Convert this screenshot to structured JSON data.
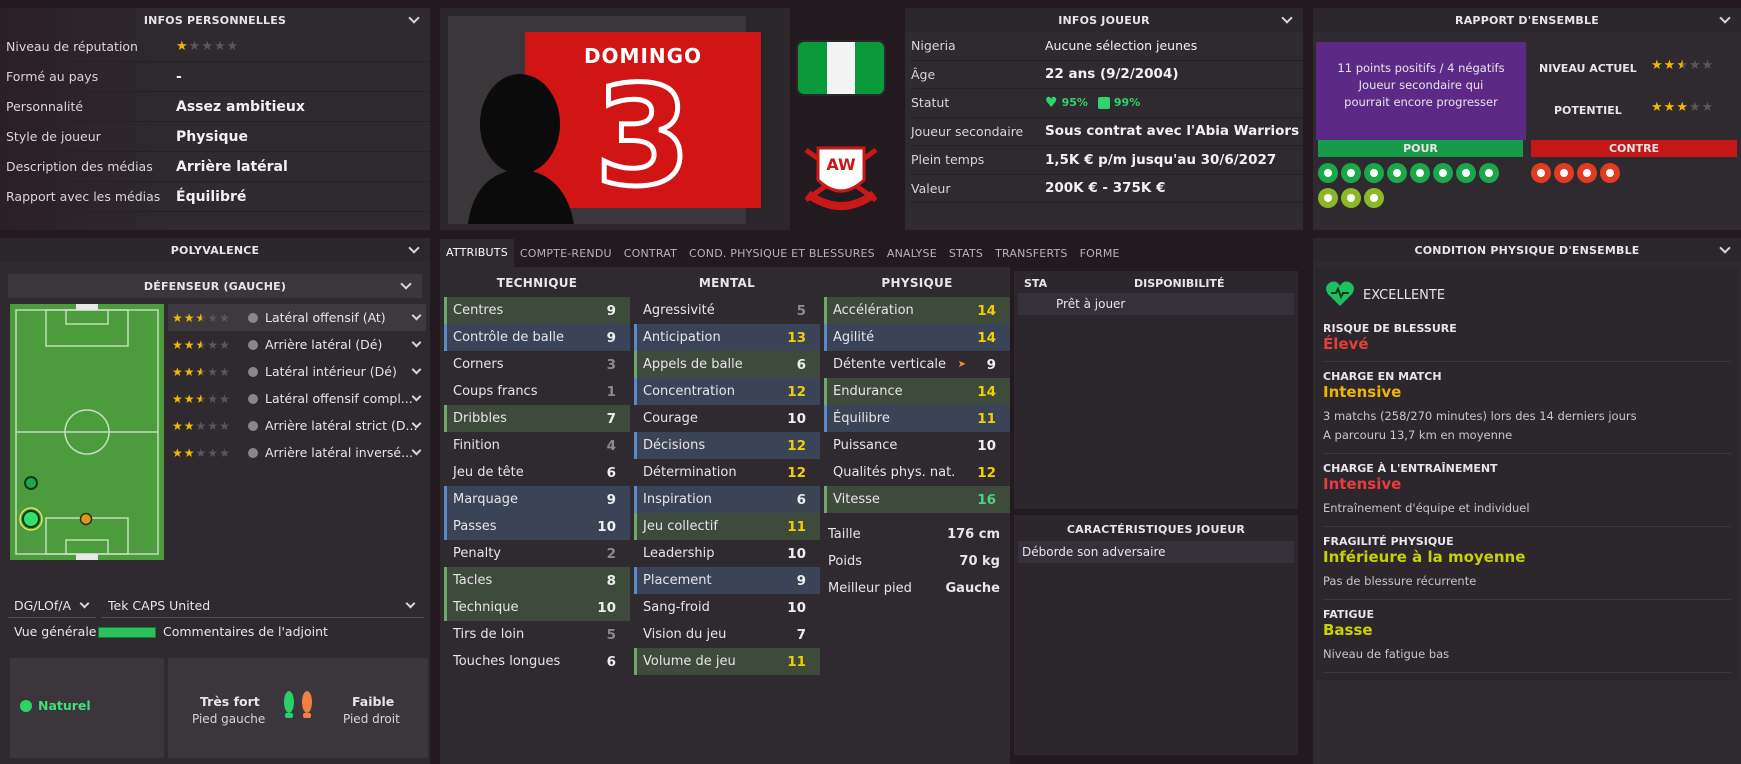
{
  "personal": {
    "header": "INFOS PERSONNELLES",
    "rows": [
      {
        "label": "Niveau de réputation",
        "value": "",
        "stars": 1
      },
      {
        "label": "Formé au pays",
        "value": "-"
      },
      {
        "label": "Personnalité",
        "value": "Assez ambitieux"
      },
      {
        "label": "Style de joueur",
        "value": "Physique"
      },
      {
        "label": "Description des médias",
        "value": "Arrière latéral"
      },
      {
        "label": "Rapport avec les médias",
        "value": "Équilibré"
      }
    ]
  },
  "shirt": {
    "name": "DOMINGO",
    "number": "3"
  },
  "club_badge": {
    "text": "ABIA WARRIORS FC"
  },
  "player_info": {
    "header": "INFOS JOUEUR",
    "rows": [
      {
        "label": "Nigeria",
        "value": "Aucune sélection jeunes"
      },
      {
        "label": "Âge",
        "value": "22 ans (9/2/2004)"
      },
      {
        "label": "Statut",
        "value": ""
      },
      {
        "label": "Joueur secondaire",
        "value": "Sous contrat avec l'Abia Warriors"
      },
      {
        "label": "Plein temps",
        "value": "1,5K € p/m jusqu'au 30/6/2027"
      },
      {
        "label": "Valeur",
        "value": "200K € - 375K €"
      }
    ],
    "status": {
      "condition": "95%",
      "morale": "99%"
    }
  },
  "overview": {
    "header": "RAPPORT D'ENSEMBLE",
    "summary_line1": "11 points positifs / 4 négatifs",
    "summary_line2": "Joueur secondaire qui pourrait encore progresser",
    "current_label": "NIVEAU ACTUEL",
    "current_stars": 2.5,
    "potential_label": "POTENTIEL",
    "potential_stars": 3,
    "pour": "POUR",
    "contre": "CONTRE",
    "pour_count": 11,
    "contre_count": 4
  },
  "versatility": {
    "header": "POLYVALENCE",
    "position_header": "DÉFENSEUR (GAUCHE)",
    "roles": [
      {
        "stars": 2.5,
        "label": "Latéral offensif (At)"
      },
      {
        "stars": 2.5,
        "label": "Arrière latéral (Dé)"
      },
      {
        "stars": 2.5,
        "label": "Latéral intérieur (Dé)"
      },
      {
        "stars": 2.5,
        "label": "Latéral offensif compl..."
      },
      {
        "stars": 2,
        "label": "Arrière latéral strict (D..."
      },
      {
        "stars": 2,
        "label": "Arrière latéral inversé..."
      }
    ],
    "position_select": "DG/LOf/A",
    "team_select": "Tek CAPS United",
    "overview_label": "Vue générale",
    "assistant_label": "Commentaires de l'adjoint",
    "natural_label": "Naturel",
    "left_foot_top": "Très fort",
    "left_foot_bottom": "Pied gauche",
    "right_foot_top": "Faible",
    "right_foot_bottom": "Pied droit"
  },
  "tabs": [
    "ATTRIBUTS",
    "COMPTE-RENDU",
    "CONTRAT",
    "COND. PHYSIQUE ET BLESSURES",
    "ANALYSE",
    "STATS",
    "TRANSFERTS",
    "FORME"
  ],
  "attributes": {
    "technique_header": "TECHNIQUE",
    "mental_header": "MENTAL",
    "physique_header": "PHYSIQUE",
    "technique": [
      {
        "label": "Centres",
        "value": "9",
        "hl": "g",
        "c": "c1"
      },
      {
        "label": "Contrôle de balle",
        "value": "9",
        "hl": "b",
        "c": "c1"
      },
      {
        "label": "Corners",
        "value": "3",
        "hl": "",
        "c": "c2"
      },
      {
        "label": "Coups francs",
        "value": "1",
        "hl": "",
        "c": "c2"
      },
      {
        "label": "Dribbles",
        "value": "7",
        "hl": "g",
        "c": "c1"
      },
      {
        "label": "Finition",
        "value": "4",
        "hl": "",
        "c": "c2"
      },
      {
        "label": "Jeu de tête",
        "value": "6",
        "hl": "",
        "c": "c1"
      },
      {
        "label": "Marquage",
        "value": "9",
        "hl": "b",
        "c": "c1"
      },
      {
        "label": "Passes",
        "value": "10",
        "hl": "b",
        "c": "c1"
      },
      {
        "label": "Penalty",
        "value": "2",
        "hl": "",
        "c": "c2"
      },
      {
        "label": "Tacles",
        "value": "8",
        "hl": "g",
        "c": "c1"
      },
      {
        "label": "Technique",
        "value": "10",
        "hl": "g",
        "c": "c1"
      },
      {
        "label": "Tirs de loin",
        "value": "5",
        "hl": "",
        "c": "c2"
      },
      {
        "label": "Touches longues",
        "value": "6",
        "hl": "",
        "c": "c1"
      }
    ],
    "mental": [
      {
        "label": "Agressivité",
        "value": "5",
        "hl": "",
        "c": "c2"
      },
      {
        "label": "Anticipation",
        "value": "13",
        "hl": "b",
        "c": "cy"
      },
      {
        "label": "Appels de balle",
        "value": "6",
        "hl": "g",
        "c": "c1"
      },
      {
        "label": "Concentration",
        "value": "12",
        "hl": "b",
        "c": "cy"
      },
      {
        "label": "Courage",
        "value": "10",
        "hl": "",
        "c": "c1"
      },
      {
        "label": "Décisions",
        "value": "12",
        "hl": "b",
        "c": "cy"
      },
      {
        "label": "Détermination",
        "value": "12",
        "hl": "",
        "c": "cy"
      },
      {
        "label": "Inspiration",
        "value": "6",
        "hl": "b",
        "c": "c1"
      },
      {
        "label": "Jeu collectif",
        "value": "11",
        "hl": "g",
        "c": "cy"
      },
      {
        "label": "Leadership",
        "value": "10",
        "hl": "",
        "c": "c1"
      },
      {
        "label": "Placement",
        "value": "9",
        "hl": "b",
        "c": "c1"
      },
      {
        "label": "Sang-froid",
        "value": "10",
        "hl": "",
        "c": "c1"
      },
      {
        "label": "Vision du jeu",
        "value": "7",
        "hl": "",
        "c": "c1"
      },
      {
        "label": "Volume de jeu",
        "value": "11",
        "hl": "g",
        "c": "cy"
      }
    ],
    "physique": [
      {
        "label": "Accélération",
        "value": "14",
        "hl": "g",
        "c": "cy"
      },
      {
        "label": "Agilité",
        "value": "14",
        "hl": "b",
        "c": "cy"
      },
      {
        "label": "Détente verticale",
        "value": "9",
        "hl": "",
        "c": "c1"
      },
      {
        "label": "Endurance",
        "value": "14",
        "hl": "g",
        "c": "cy"
      },
      {
        "label": "Équilibre",
        "value": "11",
        "hl": "b",
        "c": "cy"
      },
      {
        "label": "Puissance",
        "value": "10",
        "hl": "",
        "c": "c1"
      },
      {
        "label": "Qualités phys. nat.",
        "value": "12",
        "hl": "",
        "c": "cy"
      },
      {
        "label": "Vitesse",
        "value": "16",
        "hl": "g",
        "c": "cg"
      }
    ],
    "height_label": "Taille",
    "height_value": "176 cm",
    "weight_label": "Poids",
    "weight_value": "70 kg",
    "foot_label": "Meilleur pied",
    "foot_value": "Gauche"
  },
  "availability": {
    "sta": "STA",
    "header": "DISPONIBILITÉ",
    "value": "Prêt à jouer"
  },
  "traits": {
    "header": "CARACTÉRISTIQUES JOUEUR",
    "items": [
      "Déborde son adversaire"
    ]
  },
  "condition": {
    "header": "CONDITION PHYSIQUE D'ENSEMBLE",
    "overall": "EXCELLENTE",
    "sections": [
      {
        "title": "RISQUE DE BLESSURE",
        "value": "Élevé",
        "color": "#e83c3c",
        "notes": []
      },
      {
        "title": "CHARGE EN MATCH",
        "value": "Intensive",
        "color": "#f0b400",
        "notes": [
          "3 matchs (258/270 minutes) lors des 14 derniers jours",
          "A parcouru 13,7 km en moyenne"
        ]
      },
      {
        "title": "CHARGE À L'ENTRAÎNEMENT",
        "value": "Intensive",
        "color": "#e83c3c",
        "notes": [
          "Entraînement d'équipe et individuel"
        ]
      },
      {
        "title": "FRAGILITÉ PHYSIQUE",
        "value": "Inférieure à la moyenne",
        "color": "#c8d200",
        "notes": [
          "Pas de blessure récurrente"
        ]
      },
      {
        "title": "FATIGUE",
        "value": "Basse",
        "color": "#c8d200",
        "notes": [
          "Niveau de fatigue bas"
        ]
      }
    ]
  }
}
